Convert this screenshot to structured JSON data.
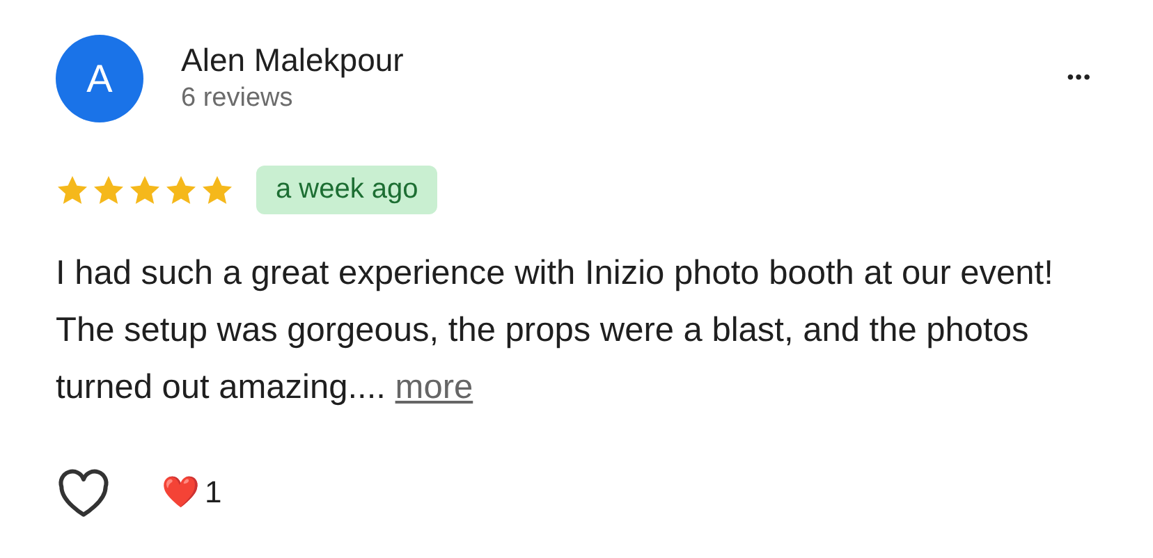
{
  "review": {
    "avatar_letter": "A",
    "author": "Alen Malekpour",
    "review_count": "6 reviews",
    "more_menu": "•••",
    "stars": 5,
    "time": "a week ago",
    "text": "I had such a great experience with Inizio photo booth at our event! The setup was gorgeous, the props were a blast, and the photos turned out amazing....",
    "more_link": "more",
    "liked": false,
    "reaction": "❤️",
    "reaction_count": "1"
  }
}
